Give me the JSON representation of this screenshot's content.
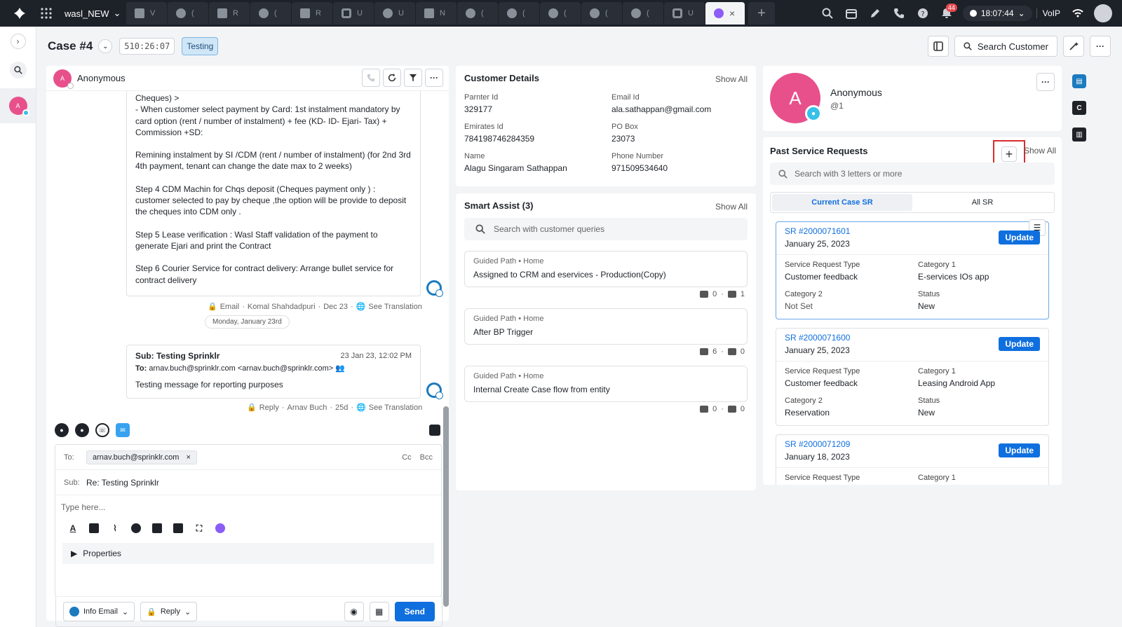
{
  "topbar": {
    "workspace": "wasl_NEW",
    "tabs": [
      "V",
      "(",
      "R",
      "(",
      "R",
      "U",
      "U",
      "N",
      "(",
      "(",
      "(",
      "(",
      "(",
      "U",
      ""
    ],
    "notifications": "44",
    "clock": "18:07:44",
    "voip": "VoIP"
  },
  "case": {
    "title": "Case #4",
    "timer": "510:26:07",
    "status": "Testing",
    "search_customer": "Search Customer"
  },
  "conversation": {
    "name": "Anonymous",
    "avatar": "A",
    "message1": [
      "Cheques) >\n- When customer select payment by Card: 1st instalment mandatory by card option (rent / number of instalment) + fee (KD- ID- Ejari- Tax) + Commission +SD:",
      "Remining instalment by SI /CDM (rent / number of instalment) (for 2nd 3rd 4th payment, tenant can change the date max to 2 weeks)",
      "Step 4 CDM Machin for Chqs deposit (Cheques payment only ) : customer selected to pay by cheque ,the option will be provide to deposit the cheques into CDM only .",
      "Step 5 Lease verification : Wasl Staff validation of the payment to generate Ejari and print the Contract",
      "Step 6 Courier Service for contract delivery: Arrange bullet service for contract delivery"
    ],
    "message1_meta": {
      "channel": "Email",
      "author": "Komal Shahdadpuri",
      "date": "Dec 23",
      "translation": "See Translation"
    },
    "date_separator": "Monday, January 23rd",
    "message2": {
      "subject": "Sub: Testing Sprinklr",
      "datetime": "23 Jan 23, 12:02 PM",
      "to_label": "To:",
      "to": "arnav.buch@sprinklr.com <arnav.buch@sprinklr.com>",
      "body": "Testing message for reporting purposes"
    },
    "message2_meta": {
      "channel": "Reply",
      "author": "Arnav Buch",
      "date": "25d",
      "translation": "See Translation"
    }
  },
  "composer": {
    "to_label": "To:",
    "to_chip": "arnav.buch@sprinklr.com",
    "cc": "Cc",
    "bcc": "Bcc",
    "sub_label": "Sub:",
    "subject": "Re: Testing Sprinklr",
    "placeholder": "Type here...",
    "properties": "Properties",
    "from_account": "Info Email",
    "reply_type": "Reply",
    "send": "Send"
  },
  "customer_details": {
    "title": "Customer Details",
    "show_all": "Show All",
    "fields": [
      {
        "label": "Parnter Id",
        "value": "329177"
      },
      {
        "label": "Email Id",
        "value": "ala.sathappan@gmail.com"
      },
      {
        "label": "Emirates Id",
        "value": "784198746284359"
      },
      {
        "label": "PO Box",
        "value": "23073"
      },
      {
        "label": "Name",
        "value": "Alagu Singaram Sathappan"
      },
      {
        "label": "Phone Number",
        "value": "971509534640"
      }
    ]
  },
  "smart_assist": {
    "title": "Smart Assist (3)",
    "show_all": "Show All",
    "search_placeholder": "Search with customer queries",
    "items": [
      {
        "crumb": "Guided Path • Home",
        "title": "Assigned to CRM and eservices - Production(Copy)",
        "up": "0",
        "down": "1"
      },
      {
        "crumb": "Guided Path • Home",
        "title": "After BP Trigger",
        "up": "6",
        "down": "0"
      },
      {
        "crumb": "Guided Path • Home",
        "title": "Internal Create Case flow from entity",
        "up": "0",
        "down": "0"
      }
    ]
  },
  "profile": {
    "avatar": "A",
    "name": "Anonymous",
    "handle": "@1"
  },
  "past_sr": {
    "title": "Past Service Requests",
    "show_all": "Show All",
    "search_placeholder": "Search with 3 letters or more",
    "tabs": [
      "Current Case SR",
      "All SR"
    ],
    "update_label": "Update",
    "labels": {
      "type": "Service Request Type",
      "cat1": "Category 1",
      "cat2": "Category 2",
      "status": "Status"
    },
    "cards": [
      {
        "id": "SR #2000071601",
        "date": "January 25, 2023",
        "type": "Customer feedback",
        "cat1": "E-services IOs app",
        "cat2": "Not Set",
        "status": "New"
      },
      {
        "id": "SR #2000071600",
        "date": "January 25, 2023",
        "type": "Customer feedback",
        "cat1": "Leasing Android App",
        "cat2": "Reservation",
        "status": "New"
      },
      {
        "id": "SR #2000071209",
        "date": "January 18, 2023",
        "type": "",
        "cat1": "",
        "cat2": "",
        "status": ""
      }
    ]
  },
  "rail": {
    "avatar": "A",
    "right_c": "C"
  }
}
